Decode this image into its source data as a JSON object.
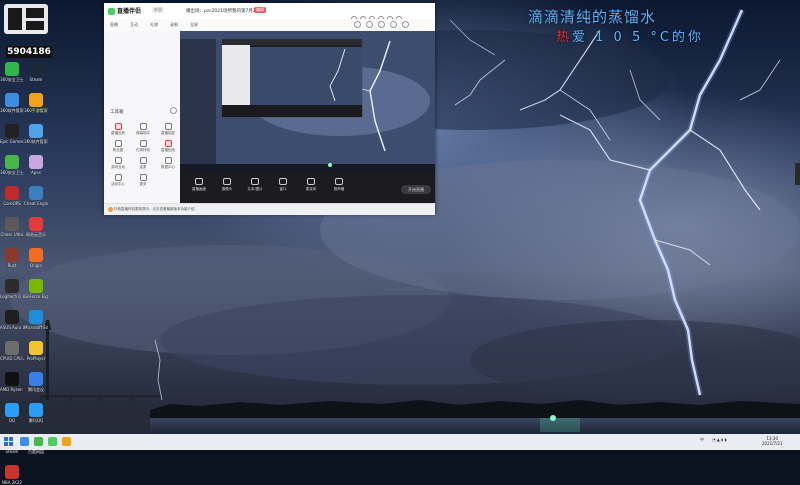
{
  "overlay": {
    "line1": "滴滴清纯的蒸馏水",
    "line2_accent": "热",
    "line2_rest": "爱 1 0 5 °C的你"
  },
  "stream_badge": {
    "room_number": "5904186"
  },
  "desktop_icons": [
    {
      "label": "360安全卫士",
      "color": "#2fb84a"
    },
    {
      "label": "Steam",
      "color": "#1b2838"
    },
    {
      "label": "360软件管家",
      "color": "#3c8de0"
    },
    {
      "label": "360手游管家",
      "color": "#f2a31b"
    },
    {
      "label": "Epic Games Launcher",
      "color": "#222222"
    },
    {
      "label": "360软件管家",
      "color": "#4fa3e8"
    },
    {
      "label": "360安全卫士",
      "color": "#49b649"
    },
    {
      "label": "Apex",
      "color": "#c7a8e0"
    },
    {
      "label": "CoreOPS",
      "color": "#c02a2a"
    },
    {
      "label": "Cheat Engine",
      "color": "#3c7fc0"
    },
    {
      "label": "Chess Ultra",
      "color": "#5a5a5a"
    },
    {
      "label": "网易云音乐",
      "color": "#e23b3b"
    },
    {
      "label": "Rust",
      "color": "#8a3a2a"
    },
    {
      "label": "Origin",
      "color": "#f26c21"
    },
    {
      "label": "Logitech G HUB",
      "color": "#2b2b2b"
    },
    {
      "label": "GeForce Experience",
      "color": "#76b900"
    },
    {
      "label": "ASUS Aura Lighting",
      "color": "#1e1e1e"
    },
    {
      "label": "Microsoft Edge",
      "color": "#1f8fdc"
    },
    {
      "label": "CPUID CPU-Z",
      "color": "#6d6d6d"
    },
    {
      "label": "ProPlayer",
      "color": "#f2c530"
    },
    {
      "label": "AMD Ryzen Master",
      "color": "#101010"
    },
    {
      "label": "腾讯会议",
      "color": "#3a7ee8"
    },
    {
      "label": "QQ",
      "color": "#2a9df4"
    },
    {
      "label": "腾讯QQ",
      "color": "#2a9df4"
    },
    {
      "label": "Steam",
      "color": "#223344"
    },
    {
      "label": "百度网盘",
      "color": "#2a7de1"
    },
    {
      "label": "NBA 2K22",
      "color": "#c9332c"
    }
  ],
  "app": {
    "name": "直播伴侣",
    "version": "新版",
    "room_title": "播出场：pzs2021场所我的第7月21",
    "edit_label": "编辑",
    "toolbar_items": [
      "直播",
      "互动",
      "礼物",
      "录制",
      "全屏"
    ],
    "tools_title": "工具箱",
    "tools": [
      {
        "label": "直播回放",
        "red": true
      },
      {
        "label": "弹幕助手",
        "red": false
      },
      {
        "label": "直播抽奖",
        "red": false
      },
      {
        "label": "粉丝团",
        "red": false
      },
      {
        "label": "礼物特效",
        "red": false
      },
      {
        "label": "直播贴纸",
        "red": true
      },
      {
        "label": "游戏互动",
        "red": false
      },
      {
        "label": "连麦",
        "red": false
      },
      {
        "label": "数据中心",
        "red": false
      },
      {
        "label": "活动中心",
        "red": false
      },
      {
        "label": "更多",
        "red": false
      }
    ],
    "controls": [
      {
        "label": "直播画面"
      },
      {
        "label": "摄像头"
      },
      {
        "label": "文本/图片"
      },
      {
        "label": "窗口"
      },
      {
        "label": "麦克风"
      },
      {
        "label": "扬声器"
      }
    ],
    "go_live": "开始直播",
    "notice": "抖音直播伴侣更新提示，点击查看最新版本功能介绍"
  },
  "taskbar": {
    "tray_text": "中",
    "clock_time": "13:30",
    "clock_date": "2021/7/21"
  },
  "colors": {
    "overlay_text": "#5ab4ff",
    "overlay_accent": "#e83232",
    "app_accent": "#4ccf62",
    "taskbar": "#e9ecf1"
  }
}
